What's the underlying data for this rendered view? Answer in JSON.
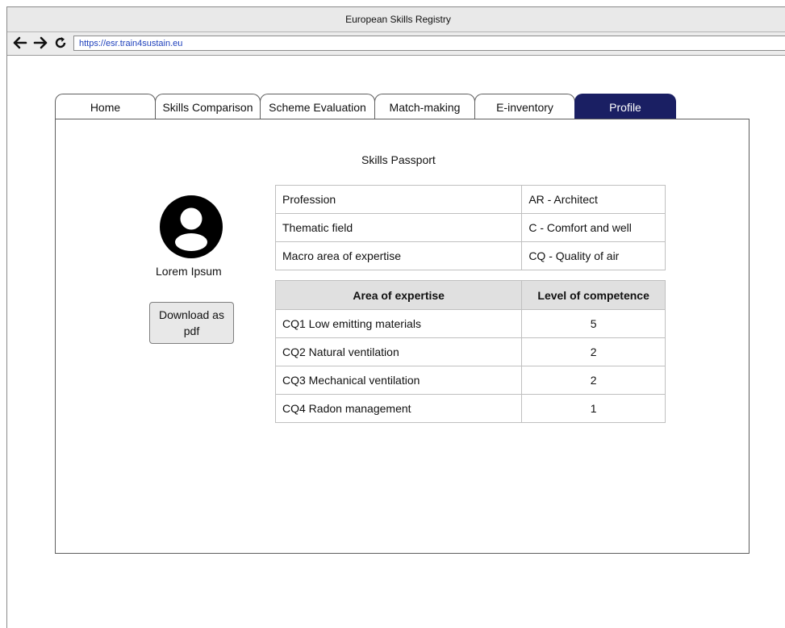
{
  "window": {
    "title": "European Skills Registry",
    "url": "https://esr.train4sustain.eu"
  },
  "tabs": [
    {
      "label": "Home"
    },
    {
      "label": "Skills Comparison"
    },
    {
      "label": "Scheme Evaluation"
    },
    {
      "label": "Match-making"
    },
    {
      "label": "E-inventory"
    },
    {
      "label": "Profile",
      "active": true
    }
  ],
  "profile": {
    "title": "Skills Passport",
    "user_name": "Lorem Ipsum",
    "download_label": "Download as pdf",
    "info": [
      {
        "label": "Profession",
        "value": "AR - Architect"
      },
      {
        "label": "Thematic field",
        "value": "C - Comfort and well"
      },
      {
        "label": "Macro area of expertise",
        "value": "CQ - Quality of air"
      }
    ],
    "skills_headers": {
      "area": "Area of expertise",
      "level": "Level of competence"
    },
    "skills": [
      {
        "area": "CQ1 Low emitting materials",
        "level": "5"
      },
      {
        "area": "CQ2 Natural ventilation",
        "level": "2"
      },
      {
        "area": "CQ3 Mechanical ventilation",
        "level": "2"
      },
      {
        "area": "CQ4 Radon management",
        "level": "1"
      }
    ]
  },
  "colors": {
    "active_tab": "#1a1f63",
    "table_header_bg": "#e0e0e0"
  },
  "icons": [
    "back-arrow-icon",
    "forward-arrow-icon",
    "reload-icon",
    "user-avatar-icon"
  ]
}
